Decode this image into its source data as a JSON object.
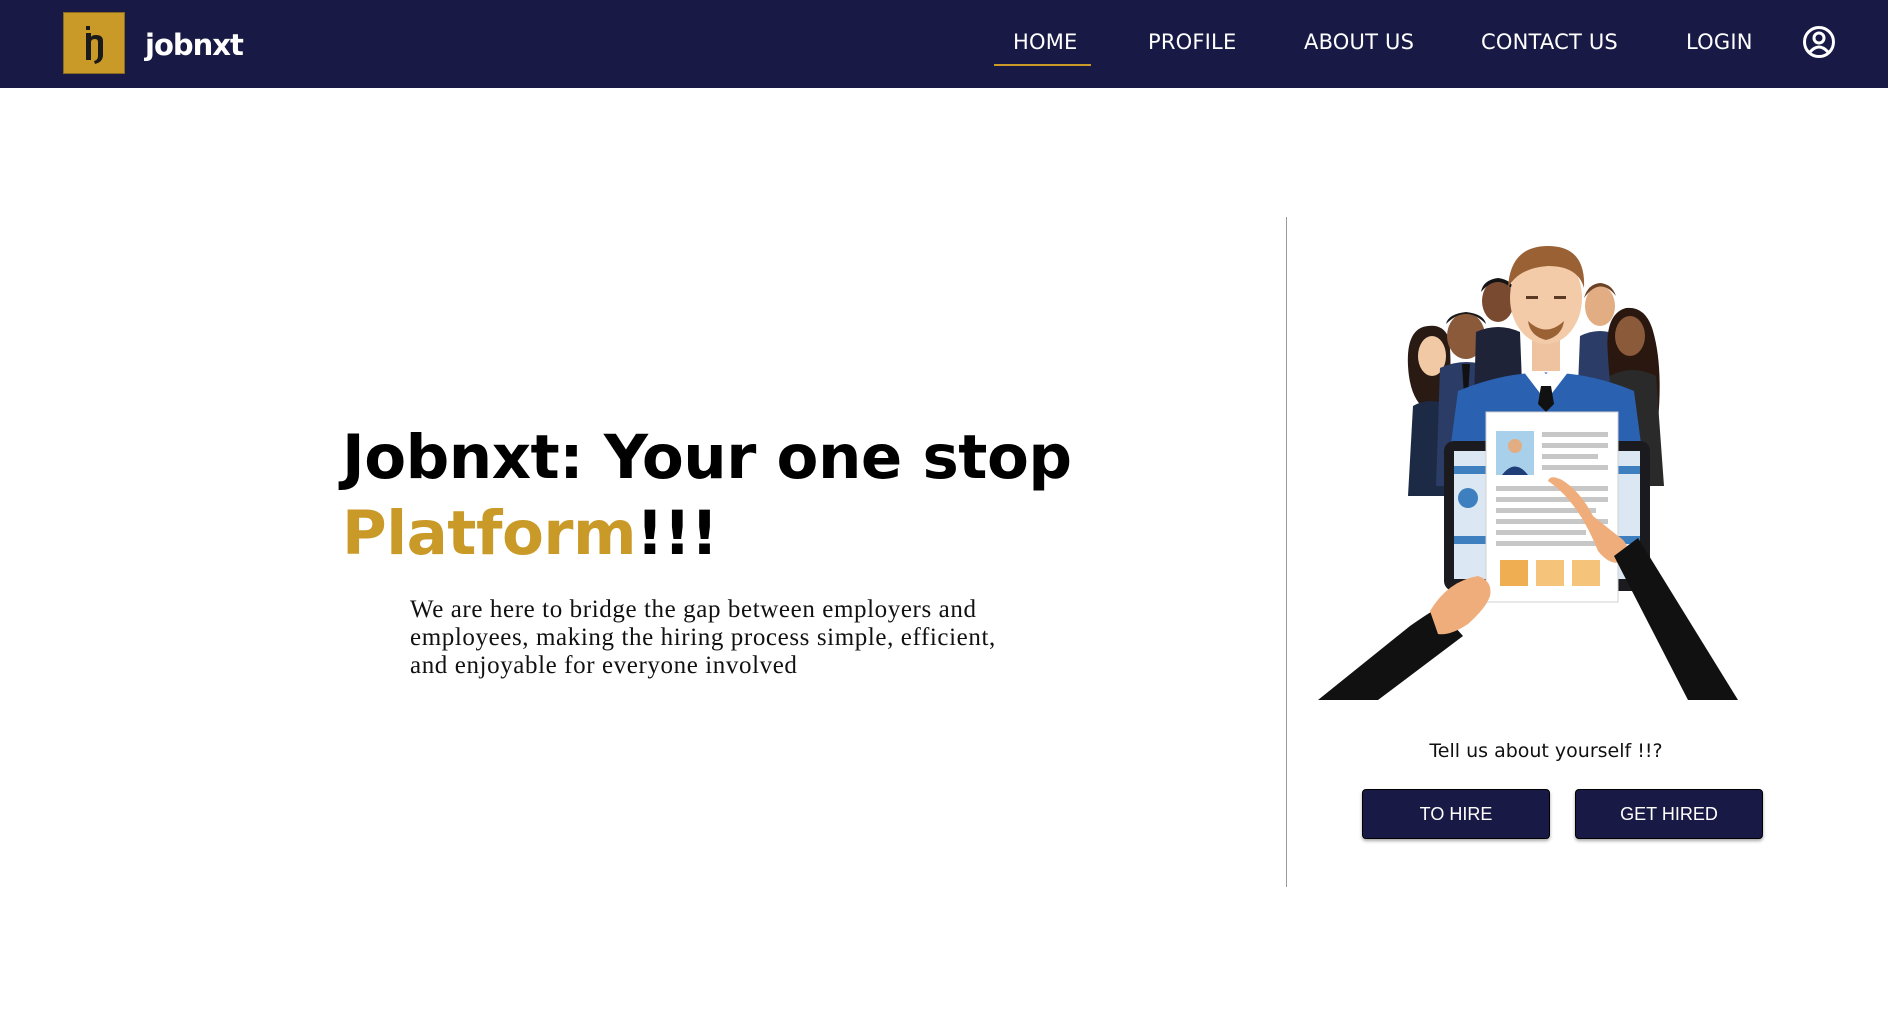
{
  "brand": {
    "name": "jobnxt",
    "logo_letter": "h"
  },
  "nav": {
    "items": [
      {
        "label": "HOME",
        "active": true
      },
      {
        "label": "PROFILE"
      },
      {
        "label": "ABOUT US"
      },
      {
        "label": "CONTACT US"
      },
      {
        "label": "LOGIN"
      }
    ],
    "account_icon": "user-circle-icon"
  },
  "hero": {
    "title_line1": "Jobnxt: Your one stop",
    "title_accent": "Platform",
    "title_suffix": "!!!",
    "description": "We are here to bridge the gap between employers and employees, making the hiring process simple, efficient, and enjoyable for everyone involved"
  },
  "cta": {
    "prompt": "Tell us about yourself !!?",
    "hire_label": "TO HIRE",
    "get_hired_label": "GET HIRED"
  },
  "colors": {
    "navbar": "#181a45",
    "accent": "#c99a27",
    "button": "#181a45"
  },
  "illustration": "recruiter-with-resume-illustration"
}
